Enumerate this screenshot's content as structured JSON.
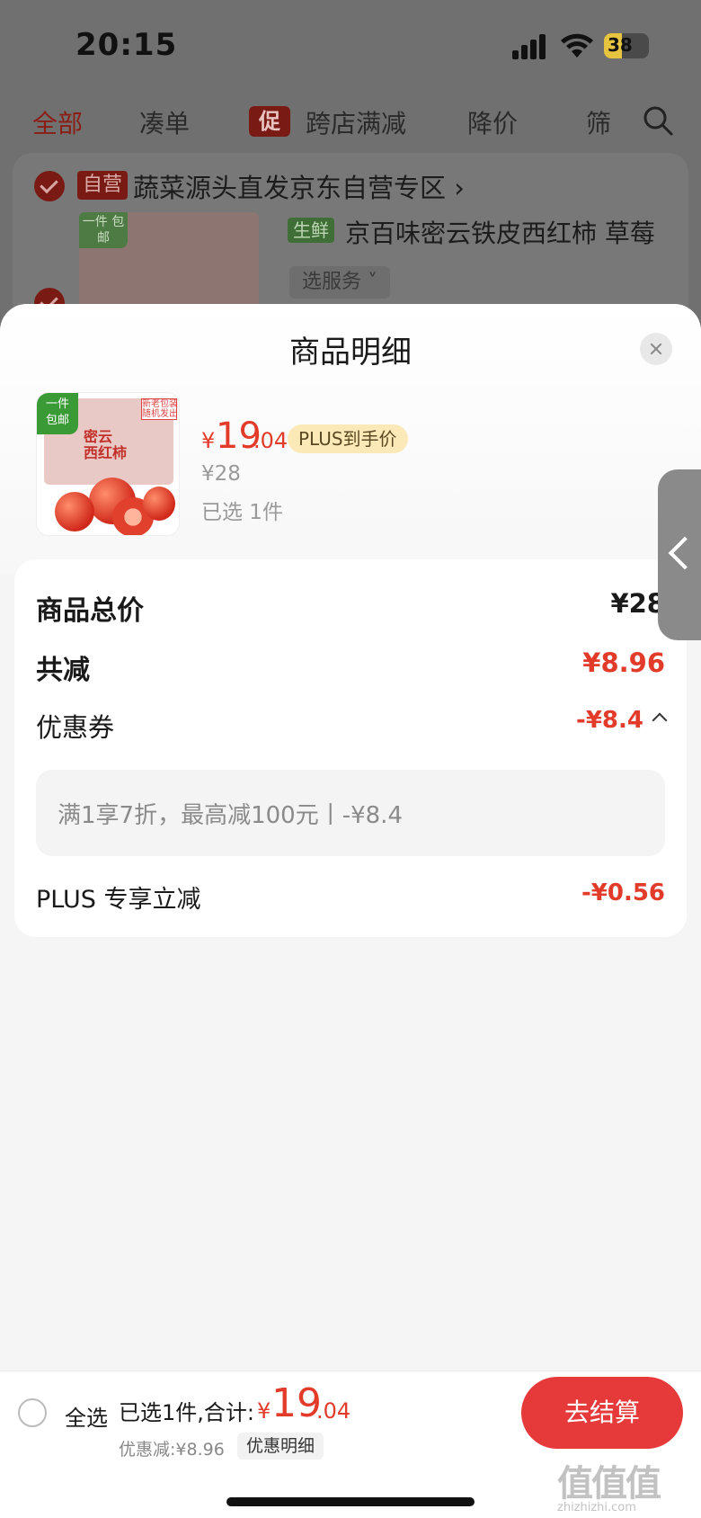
{
  "status_bar": {
    "time": "20:15",
    "battery": "38"
  },
  "tabs": [
    {
      "label": "全部",
      "active": true
    },
    {
      "label": "凑单"
    },
    {
      "label": "跨店满减",
      "promo_badge": "促"
    },
    {
      "label": "降价"
    },
    {
      "label": "筛"
    }
  ],
  "store": {
    "tag": "自营",
    "name": "蔬菜源头直发京东自营专区",
    "product_tag": "生鲜",
    "product_title": "京百味密云铁皮西红柿 草莓",
    "service": "选服务",
    "thumb_badge": "一件\n包邮"
  },
  "sheet": {
    "title": "商品明细",
    "product": {
      "price_currency": "¥",
      "price_int": "19",
      "price_dec": ".04",
      "plus_tag": "PLUS到手价",
      "original_price": "¥28",
      "selected": "已选 1件",
      "thumb_badge": "一件\n包邮",
      "thumb_box_label": "密云\n西红柿",
      "thumb_tag": "新老包装\n随机发出"
    },
    "breakdown": {
      "total_label": "商品总价",
      "total_value": "¥28",
      "discount_label": "共减",
      "discount_value": "¥8.96",
      "coupon_label": "优惠券",
      "coupon_value": "-¥8.4",
      "coupon_detail": "满1享7折，最高减100元丨-¥8.4",
      "plus_label": "PLUS 专享立减",
      "plus_value": "-¥0.56"
    }
  },
  "bottom_bar": {
    "select_all": "全选",
    "summary_label": "已选1件,合计:",
    "sum_currency": "¥",
    "sum_int": "19",
    "sum_dec": ".04",
    "discount_line": "优惠减:¥8.96",
    "detail_button": "优惠明细",
    "checkout": "去结算"
  },
  "watermark": {
    "text": "值值值",
    "url": "zhizhizhi.com"
  },
  "colors": {
    "accent": "#e23b2a",
    "checkout": "#e6393a",
    "plus_tag_bg": "#fbe9b8"
  }
}
